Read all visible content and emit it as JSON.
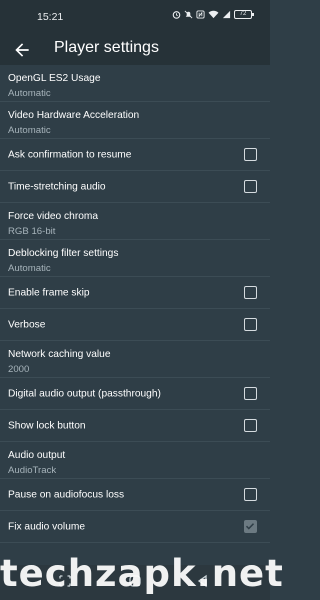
{
  "status_bar": {
    "time": "15:21",
    "battery": "72",
    "icons": [
      "alarm-icon",
      "silent-icon",
      "nfc-icon",
      "wifi-icon",
      "signal-icon",
      "battery-icon"
    ]
  },
  "app_bar": {
    "title": "Player settings",
    "back_icon": "arrow-back-icon"
  },
  "settings": [
    {
      "label": "OpenGL ES2 Usage",
      "value": "Automatic"
    },
    {
      "label": "Video Hardware Acceleration",
      "value": "Automatic"
    },
    {
      "label": "Ask confirmation to resume",
      "checked": false
    },
    {
      "label": "Time-stretching audio",
      "checked": false
    },
    {
      "label": "Force video chroma",
      "value": "RGB 16-bit"
    },
    {
      "label": "Deblocking filter settings",
      "value": "Automatic"
    },
    {
      "label": "Enable frame skip",
      "checked": false
    },
    {
      "label": "Verbose",
      "checked": false
    },
    {
      "label": "Network caching value",
      "value": "2000"
    },
    {
      "label": "Digital audio output (passthrough)",
      "checked": false
    },
    {
      "label": "Show lock button",
      "checked": false
    },
    {
      "label": "Audio output",
      "value": "AudioTrack"
    },
    {
      "label": "Pause on audiofocus loss",
      "checked": false
    },
    {
      "label": "Fix audio volume",
      "checked": true,
      "disabled": true
    }
  ],
  "nav_bar": {
    "buttons": [
      "recents-icon",
      "home-icon",
      "back-icon"
    ]
  },
  "watermark": "techzapk.net",
  "colors": {
    "background": "#2f3e47",
    "toolbar": "#263238",
    "secondary_text": "#a7b4bb"
  }
}
